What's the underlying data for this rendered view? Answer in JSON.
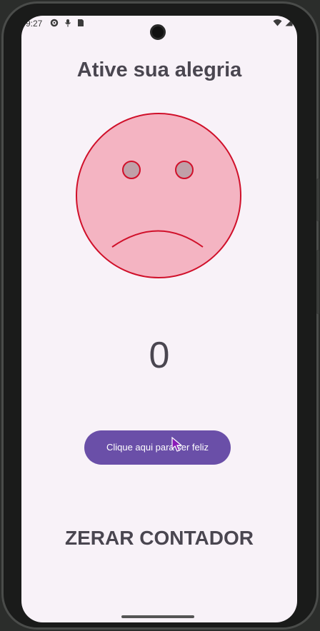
{
  "status_bar": {
    "time": "9:27",
    "left_icons": [
      "gear-icon",
      "mic-icon",
      "sim-card-icon"
    ],
    "right_icons": [
      "wifi-icon",
      "signal-icon"
    ]
  },
  "app": {
    "title": "Ative sua alegria",
    "counter": "0",
    "happy_button_label": "Clique aqui para ser feliz",
    "reset_button_label": "ZERAR CONTADOR"
  },
  "colors": {
    "face_fill": "#f4b4c2",
    "face_stroke": "#d0102a",
    "eye_fill": "#c0a0a8",
    "button_bg": "#6a4fa8",
    "screen_bg": "#f8f2f8"
  },
  "face": {
    "mood": "sad"
  }
}
